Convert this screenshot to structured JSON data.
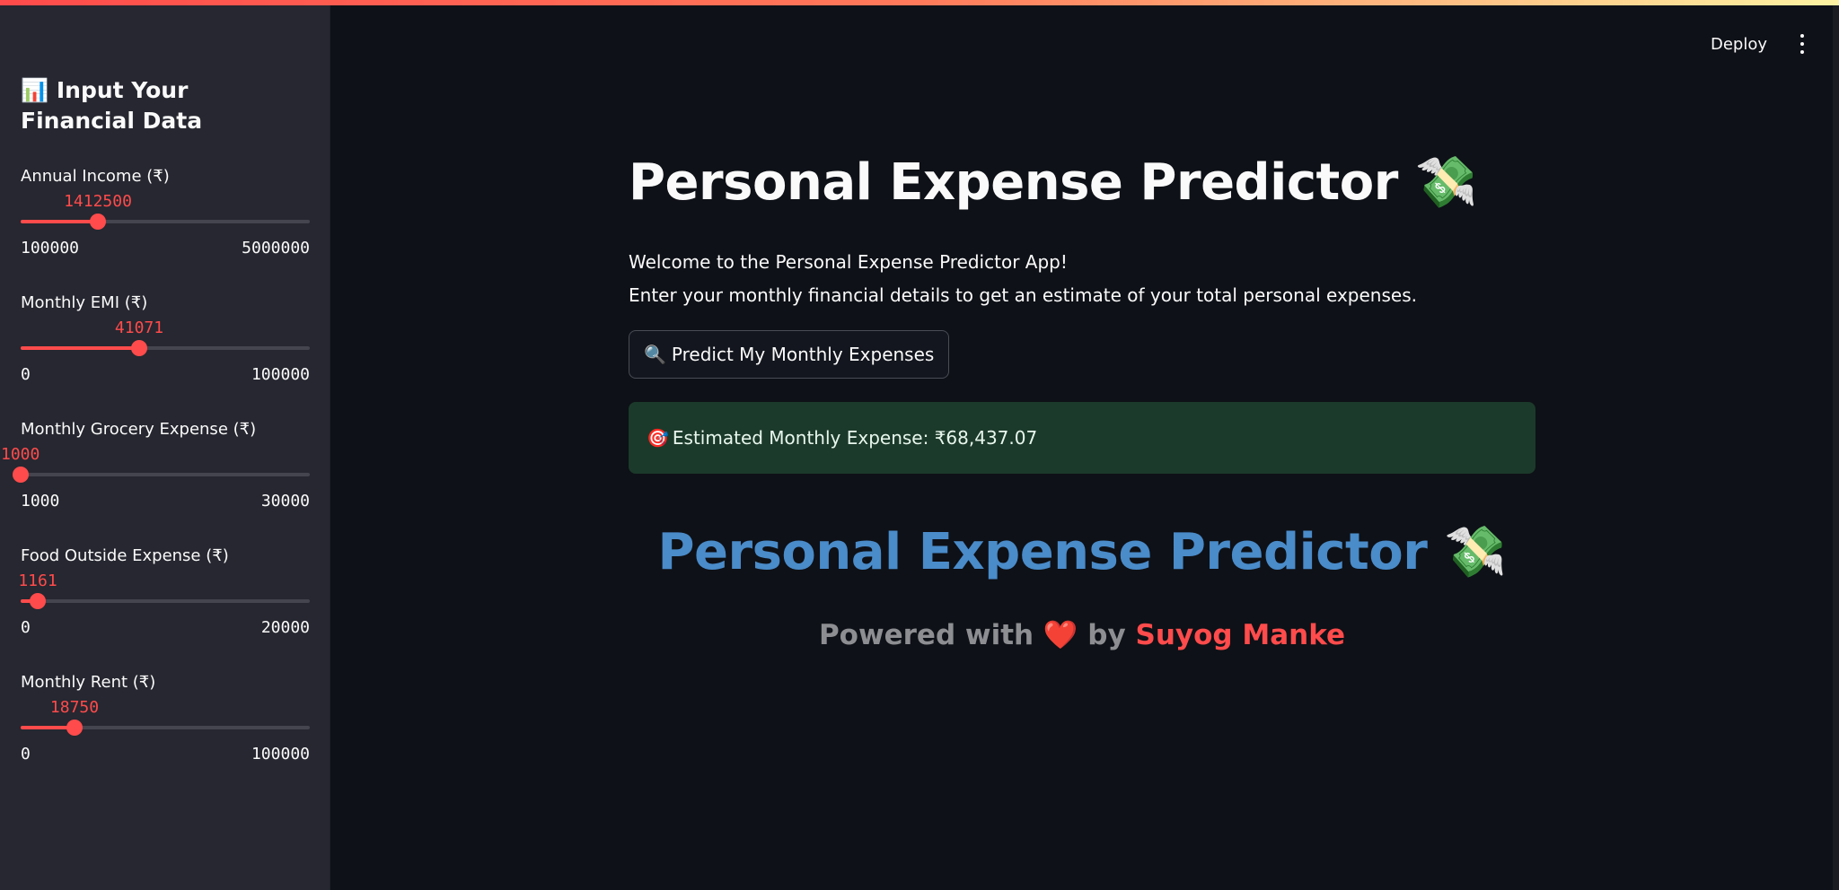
{
  "sidebar": {
    "title_icon": "📊",
    "title": "Input Your Financial Data",
    "sliders": [
      {
        "label": "Annual Income (₹)",
        "value": "1412500",
        "min": "100000",
        "max": "5000000",
        "fraction": 0.268
      },
      {
        "label": "Monthly EMI (₹)",
        "value": "41071",
        "min": "0",
        "max": "100000",
        "fraction": 0.411
      },
      {
        "label": "Monthly Grocery Expense (₹)",
        "value": "1000",
        "min": "1000",
        "max": "30000",
        "fraction": 0.0
      },
      {
        "label": "Food Outside Expense (₹)",
        "value": "1161",
        "min": "0",
        "max": "20000",
        "fraction": 0.058
      },
      {
        "label": "Monthly Rent (₹)",
        "value": "18750",
        "min": "0",
        "max": "100000",
        "fraction": 0.1875
      }
    ]
  },
  "header": {
    "deploy_label": "Deploy",
    "menu_icon": "kebab-menu-icon"
  },
  "main": {
    "title": "Personal Expense Predictor",
    "title_emoji": "💸",
    "intro_line1": "Welcome to the Personal Expense Predictor App!",
    "intro_line2": "Enter your monthly financial details to get an estimate of your total personal expenses.",
    "predict_icon": "🔍",
    "predict_button_label": "Predict My Monthly Expenses",
    "result_icon": "🎯",
    "result_text": "Estimated Monthly Expense: ₹68,437.07"
  },
  "footer": {
    "title": "Personal Expense Predictor",
    "title_emoji": "💸",
    "powered_prefix": "Powered with",
    "heart": "❤️",
    "powered_by": "by",
    "author": "Suyog Manke"
  },
  "colors": {
    "accent": "#ff4b4b",
    "footer_title": "#4a8bc9",
    "success_bg": "#1c3a2b",
    "sidebar_bg": "#262730",
    "main_bg": "#0e1117"
  }
}
